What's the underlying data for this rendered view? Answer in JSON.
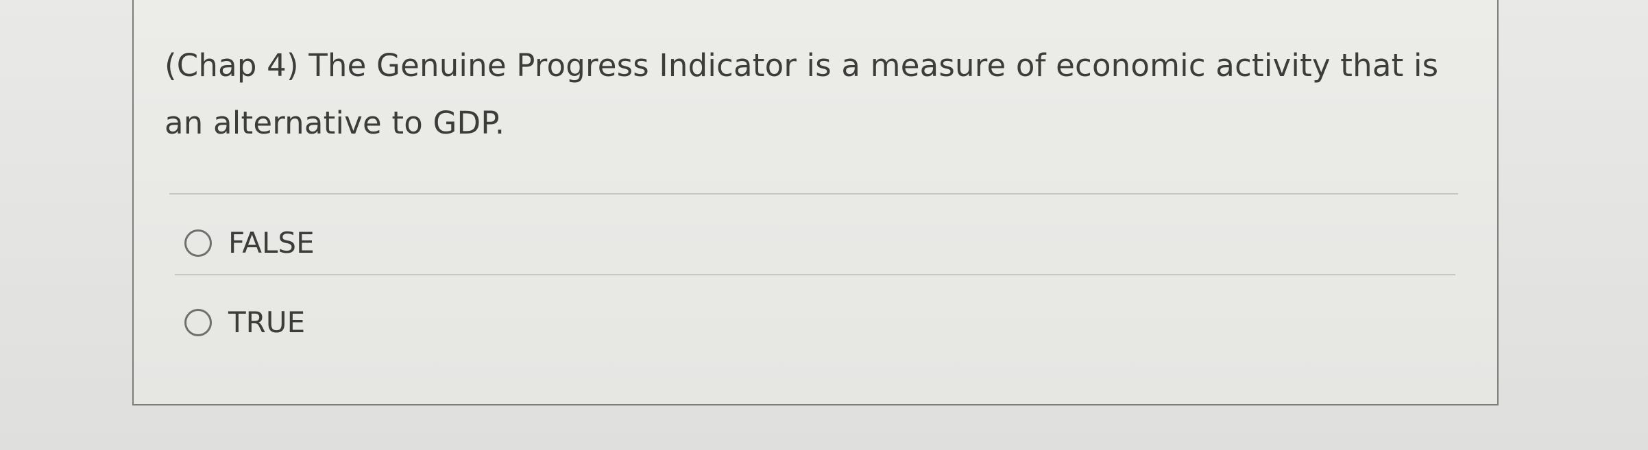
{
  "question": {
    "text": "(Chap 4) The Genuine Progress Indicator is a measure of economic activity that is an alternative to GDP."
  },
  "options": [
    {
      "label": "FALSE",
      "selected": false
    },
    {
      "label": "TRUE",
      "selected": false
    }
  ]
}
